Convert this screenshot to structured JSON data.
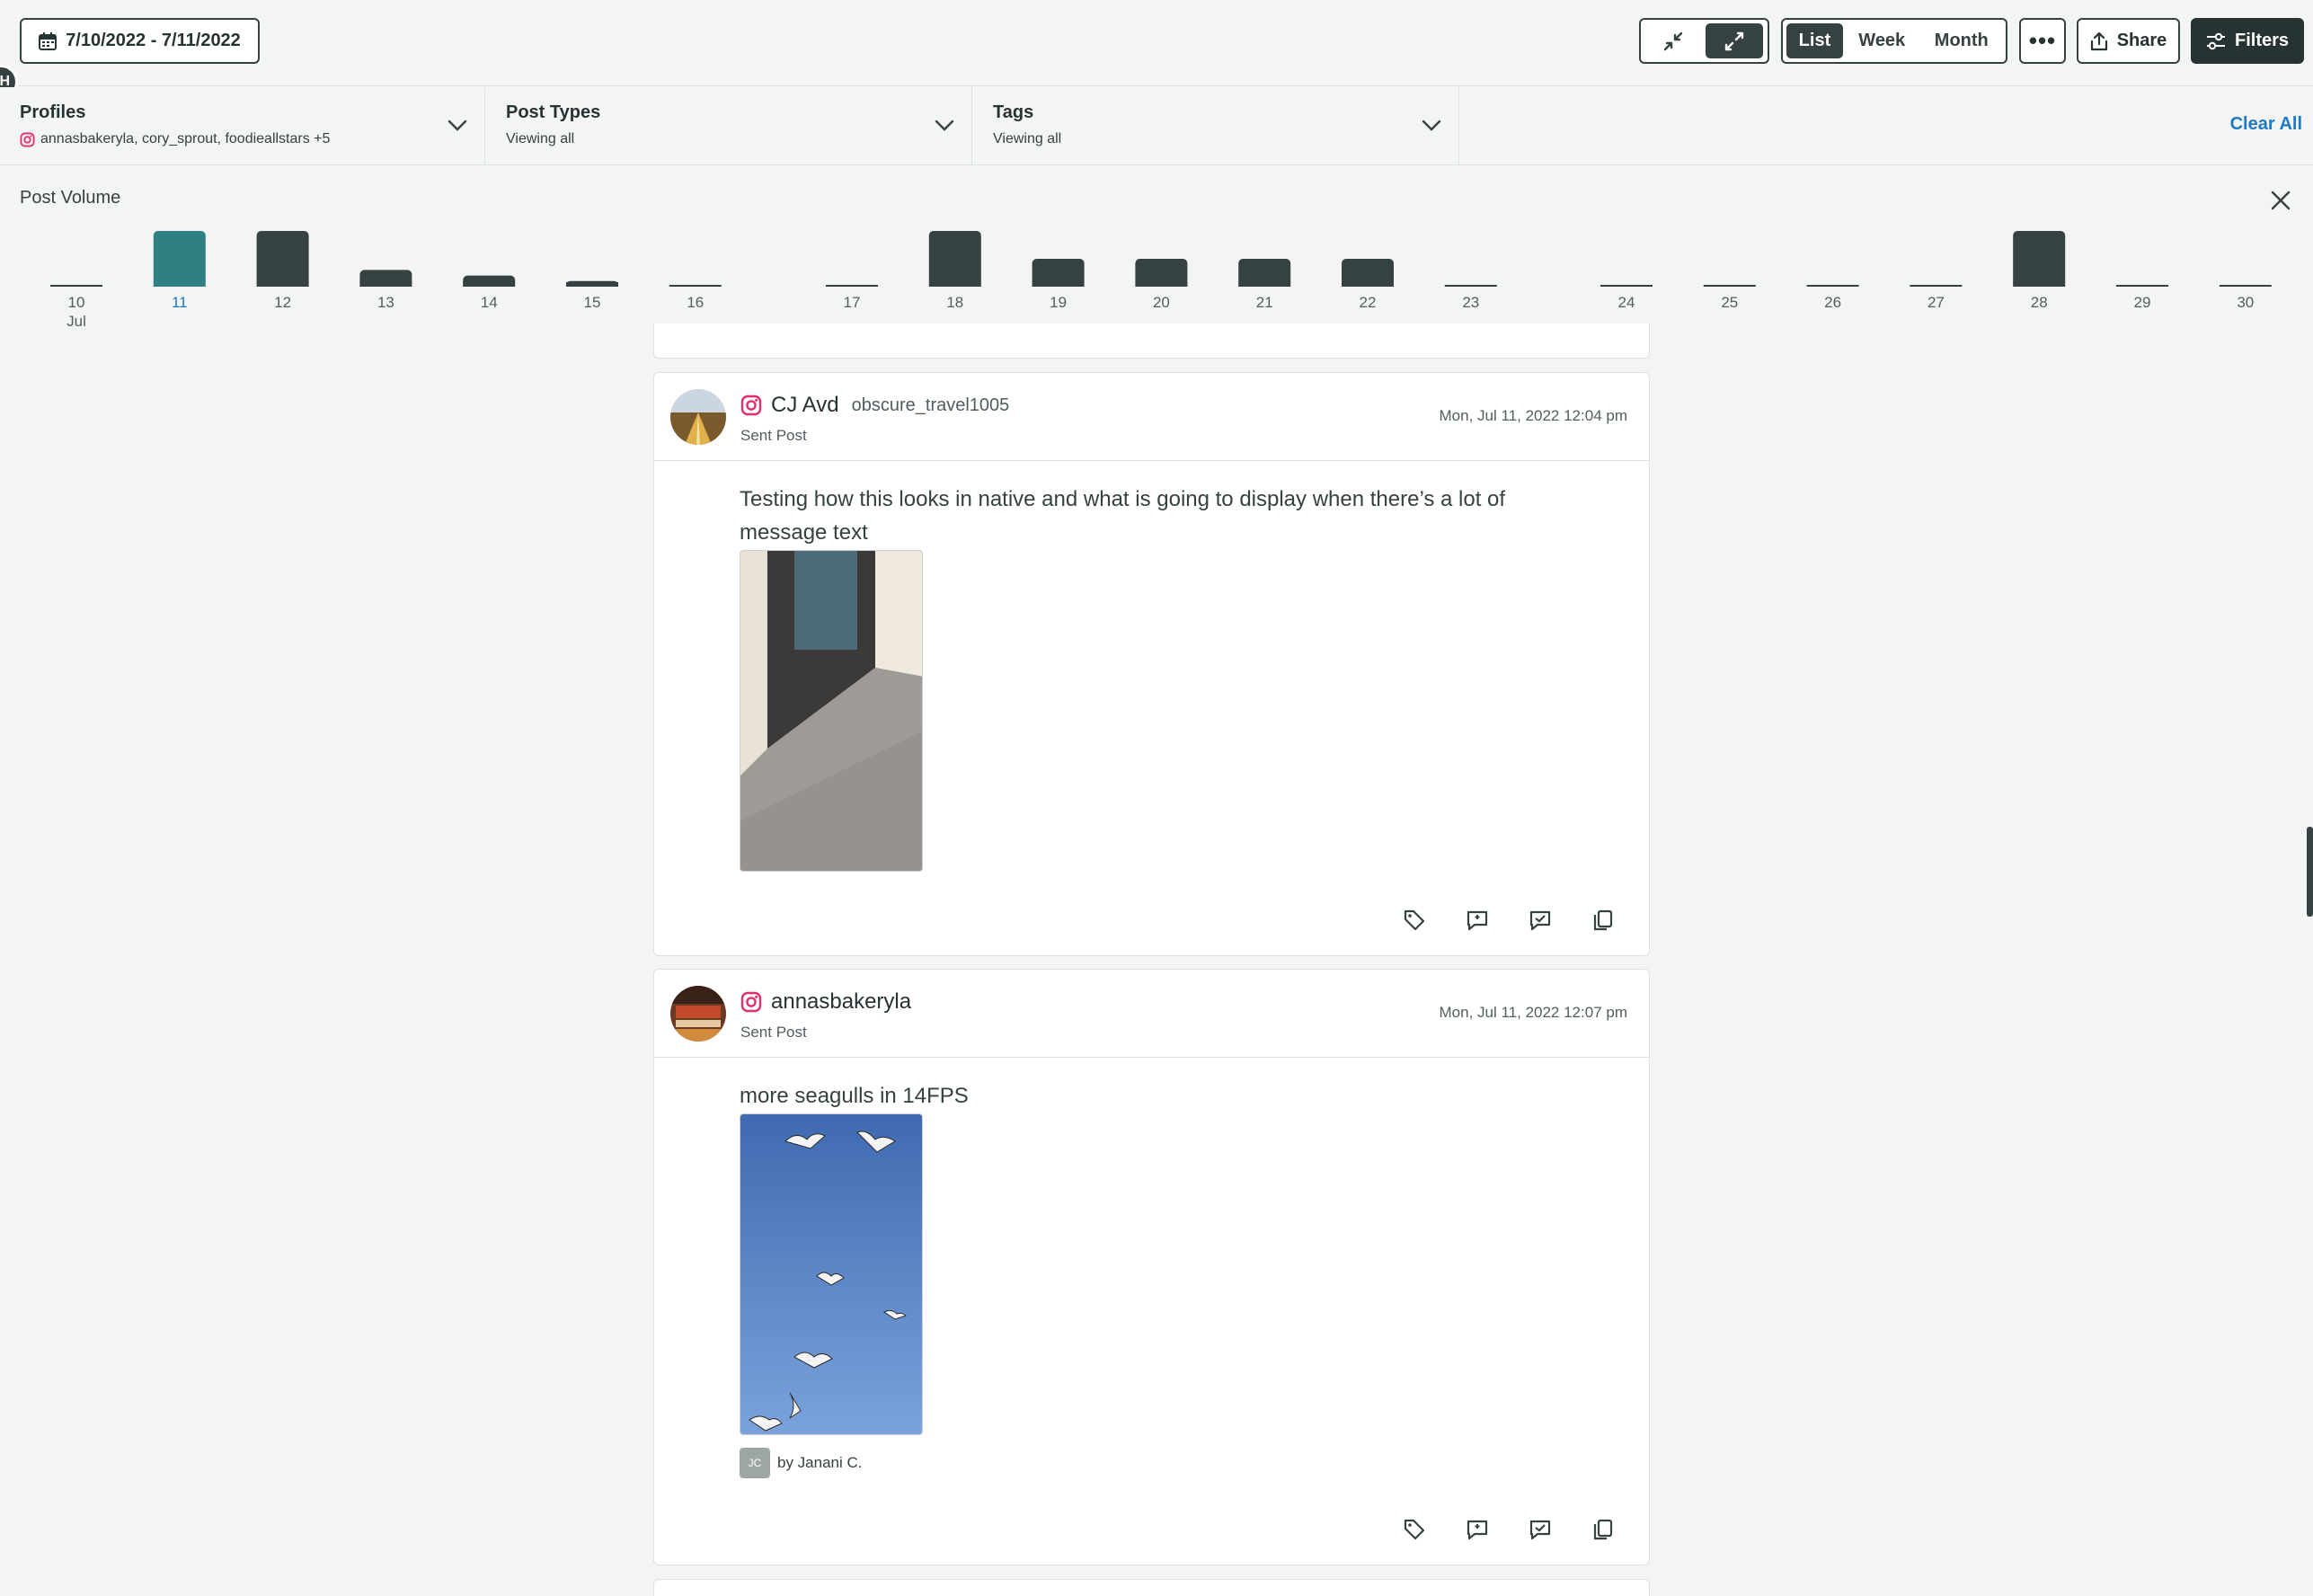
{
  "toolbar": {
    "date_range": "7/10/2022 - 7/11/2022",
    "views": [
      "List",
      "Week",
      "Month"
    ],
    "active_view": "List",
    "more_label": "•••",
    "share_label": "Share",
    "filters_label": "Filters"
  },
  "filters": {
    "profiles": {
      "title": "Profiles",
      "value": "annasbakeryla, cory_sprout, foodieallstars +5"
    },
    "post_types": {
      "title": "Post Types",
      "value": "Viewing all"
    },
    "tags": {
      "title": "Tags",
      "value": "Viewing all"
    },
    "clear_all": "Clear All"
  },
  "post_volume": {
    "title": "Post Volume",
    "month_label": "Jul"
  },
  "chart_data": {
    "type": "bar",
    "title": "Post Volume",
    "categories": [
      "10",
      "11",
      "12",
      "13",
      "14",
      "15",
      "16",
      "17",
      "18",
      "19",
      "20",
      "21",
      "22",
      "23",
      "24",
      "25",
      "26",
      "27",
      "28",
      "29",
      "30"
    ],
    "values": [
      0,
      5,
      5,
      1.5,
      1,
      0.5,
      0,
      0,
      5,
      2.5,
      2.5,
      2.5,
      2.5,
      0,
      0,
      0,
      0,
      0,
      5,
      0,
      0
    ],
    "highlighted": "11",
    "colors": {
      "bar": "#364141",
      "highlight": "#2f7f83"
    }
  },
  "posts": [
    {
      "author": "CJ Avd",
      "handle": "obscure_travel1005",
      "type": "Sent Post",
      "time": "Mon, Jul 11, 2022 12:04 pm",
      "message": "Testing how this looks in native and what is going to display when there’s a lot of message text"
    },
    {
      "author": "annasbakeryla",
      "handle": "",
      "type": "Sent Post",
      "time": "Mon, Jul 11, 2022 12:07 pm",
      "message": "more seagulls in 14FPS",
      "byline_initials": "JC",
      "byline": "by Janani C."
    }
  ],
  "edge_badge": "H"
}
